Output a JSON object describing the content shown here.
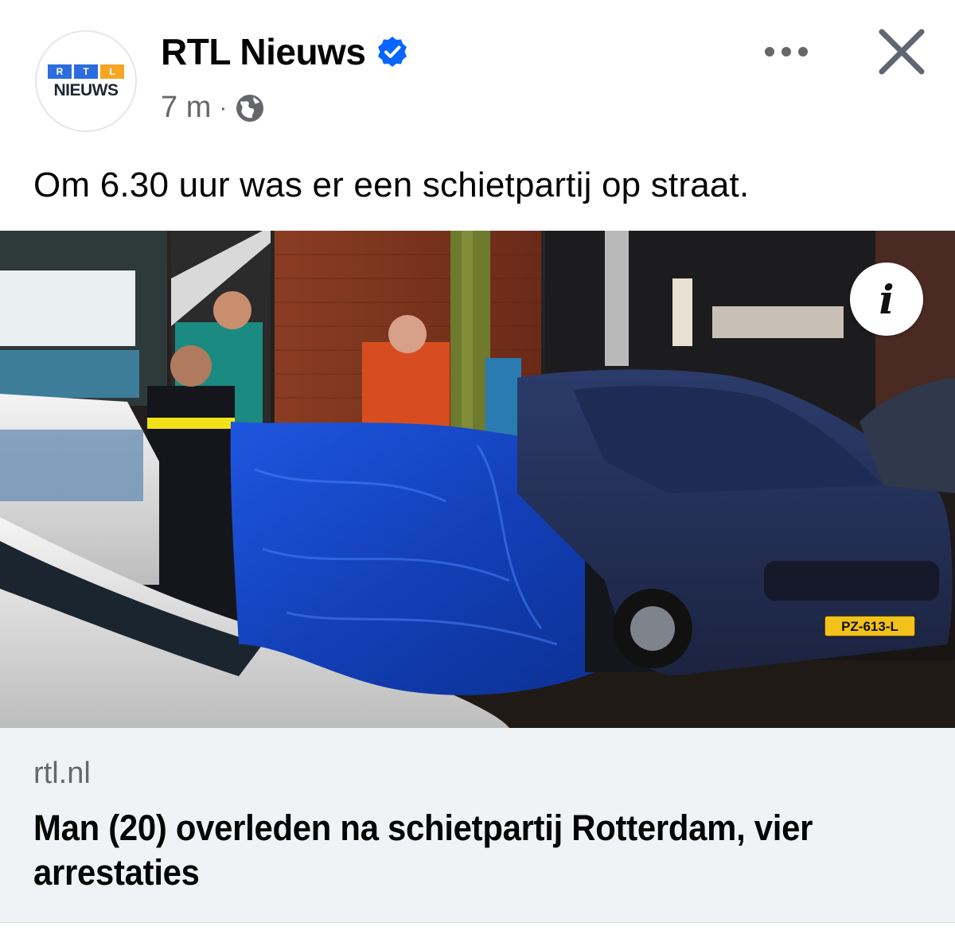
{
  "post": {
    "page_name": "RTL Nieuws",
    "verified_icon": "verified-badge-icon",
    "timestamp": "7 m",
    "separator": "·",
    "audience_icon": "globe-icon",
    "caption": "Om 6.30 uur was er een schietpartij op straat."
  },
  "avatar": {
    "letters": [
      "R",
      "T",
      "L"
    ],
    "letter_colors": [
      "#2d6cdf",
      "#2d6cdf",
      "#f5a623"
    ],
    "word": "NIEUWS"
  },
  "actions": {
    "more_icon": "more-horizontal-icon",
    "close_icon": "close-icon"
  },
  "photo": {
    "plate": "PZ-613-L",
    "info_label": "i"
  },
  "link_card": {
    "domain": "rtl.nl",
    "headline": "Man (20) overleden na schietpartij Rotterdam, vier arrestaties"
  },
  "colors": {
    "verified_blue": "#0866ff",
    "tarp_blue": "#1848c8",
    "police_yellow": "#f2e21a"
  }
}
